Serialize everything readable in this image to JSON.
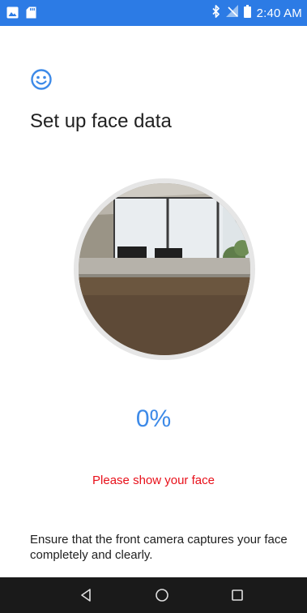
{
  "status_bar": {
    "time": "2:40 AM",
    "left_icons": [
      "image-notification-icon",
      "sd-card-icon"
    ],
    "right_icons": [
      "bluetooth-icon",
      "no-signal-icon",
      "battery-icon"
    ],
    "background_color": "#2c7be5"
  },
  "page": {
    "title": "Set up face data",
    "header_icon": "smiley-face-icon",
    "accent_color": "#3d8ae8"
  },
  "enrollment": {
    "progress_text": "0%",
    "progress_value": 0,
    "prompt": "Please show your face",
    "prompt_color": "#e8101a"
  },
  "instructions": "Ensure that the front camera captures your face completely and clearly.",
  "nav_bar": {
    "buttons": [
      "back-icon",
      "home-icon",
      "recents-icon"
    ]
  }
}
